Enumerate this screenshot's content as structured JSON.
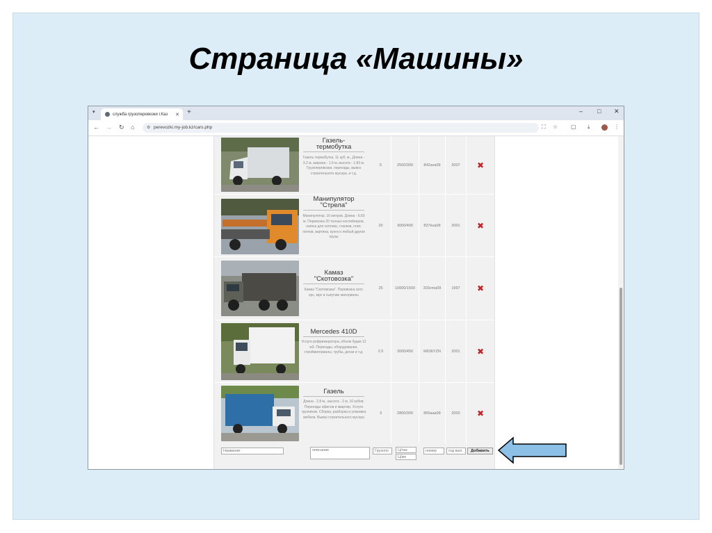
{
  "slide": {
    "title": "Страница «Машины»"
  },
  "browser": {
    "tab_title": "служба грузоперевозки г.Каз",
    "url": "perevozki.my-job.kz/cars.php",
    "new_tab": "+",
    "window_controls": [
      "–",
      "□",
      "✕"
    ]
  },
  "cars": [
    {
      "name": "Газель-\nтермобутка",
      "description": "Газель термобутка. 11 куб. м., Длина - 3.2 м, ширина - 1.9 м, высота - 1.83 м. Грузоперевозки, переезды, вывоз строительного мусора, и т.д.",
      "capacity": "5",
      "price": "2500/300",
      "plate": "842ava09",
      "year": "2007"
    },
    {
      "name": "Манипулятор\n\"Стрела\"",
      "description": "Манипулятор. 16 метров. Длина - 6.60 м. Перевозка 20 тонных контейнеров, напеш для септика, станков, плит, лотков, вартина, кунги и любый других грузы",
      "capacity": "20",
      "price": "3000/400",
      "plate": "837kua09",
      "year": "2001"
    },
    {
      "name": "Камаз\n\"Скотовозка\"",
      "description": "Камаз \"Скотовозка\". Перевозка скот, крс, мрс и сыпучие материалы",
      "capacity": "25",
      "price": "10000/1500",
      "plate": "303vma09",
      "year": "1997"
    },
    {
      "name": "Mercedes 410D",
      "description": "Услуги рефрижератора, объем будки 12 м3. Переезды, оборудования, стройматериалы, трубы, доски и т.д.",
      "capacity": "2.5",
      "price": "3000/450",
      "plate": "M636YZN",
      "year": "2001"
    },
    {
      "name": "Газель",
      "description": "Длина - 2,8 м., высота - 2 м, 16 кубов. Переезды офисов и квартир. Услуги грузчиков. Сборка, разборка и упаковка мебели. Вывоз строительного мусора",
      "capacity": "3",
      "price": "2800/300",
      "plate": "865aaa09",
      "year": "2003"
    }
  ],
  "delete_symbol": "✖",
  "form": {
    "name_placeholder": "Название",
    "desc_placeholder": "описание",
    "capacity_placeholder": "Грузопо",
    "price_placeholder": "Ц/час ",
    "price_placeholder2": "Ц/км",
    "plate_placeholder": "номер",
    "year_placeholder": "год вып.",
    "add_label": "Добавить"
  },
  "colors": {
    "slide_bg": "#dcedf8",
    "arrow_fill": "#8dc0e6",
    "delete_red": "#c0272d"
  }
}
